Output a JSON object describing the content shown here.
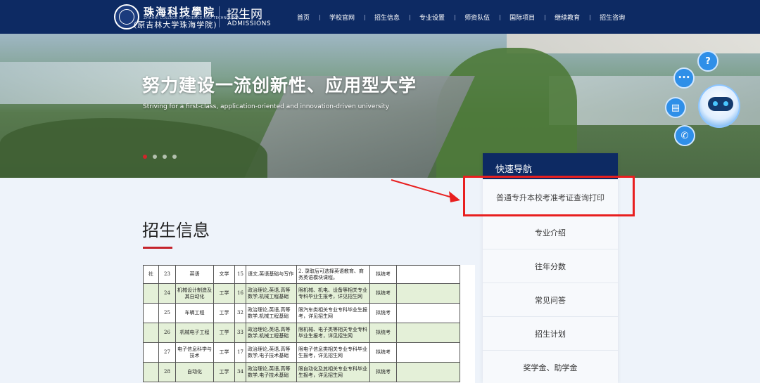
{
  "header": {
    "school_name": "珠海科技學院",
    "school_name_en": "ZHUHAI COLLEGE OF SCIENCE AND TECHNOLOGY",
    "school_sub": "(原吉林大学珠海学院)",
    "admissions_cn": "招生网",
    "admissions_en": "ADMISSIONS",
    "nav": [
      "首页",
      "学校官网",
      "招生信息",
      "专业设置",
      "师资队伍",
      "国际项目",
      "继续教育",
      "招生咨询"
    ]
  },
  "banner": {
    "title": "努力建设一流创新性、应用型大学",
    "subtitle": "Striving for a first-class, application-oriented and innovation-driven university",
    "dots": 4,
    "active_dot": 0
  },
  "assistant": {
    "icons": [
      "question-icon",
      "chat-icon",
      "book-icon",
      "phone-icon"
    ],
    "glyphs": [
      "?",
      "•••",
      "▤",
      "✆"
    ]
  },
  "main": {
    "section_title": "招生信息"
  },
  "table": {
    "rows": [
      {
        "c0": "社",
        "no": "23",
        "major": "英语",
        "cat": "文学",
        "plan": "15",
        "subjects": "语文,英语基础与写作",
        "req": "2. 录取后可选择英语教育、商务英语模块课程。",
        "mode": "拟统考",
        "style": "white"
      },
      {
        "c0": "",
        "no": "24",
        "major": "机械设计制造及其自动化",
        "cat": "工学",
        "plan": "16",
        "subjects": "政治理论,英语,高等数学,机械工程基础",
        "req": "限机械、机电、设备等相关专业专科毕业生报考，详见招生网",
        "mode": "拟统考",
        "style": "green"
      },
      {
        "c0": "",
        "no": "25",
        "major": "车辆工程",
        "cat": "工学",
        "plan": "32",
        "subjects": "政治理论,英语,高等数学,机械工程基础",
        "req": "限汽车类相关专业专科毕业生报考，详见招生网",
        "mode": "拟统考",
        "style": "white"
      },
      {
        "c0": "",
        "no": "26",
        "major": "机械电子工程",
        "cat": "工学",
        "plan": "33",
        "subjects": "政治理论,英语,高等数学,机械工程基础",
        "req": "限机械、电子类等相关专业专科毕业生报考，详见招生网",
        "mode": "拟统考",
        "style": "green"
      },
      {
        "c0": "",
        "no": "27",
        "major": "电子信息科学与技术",
        "cat": "工学",
        "plan": "17",
        "subjects": "政治理论,英语,高等数学,电子技术基础",
        "req": "限电子信息类相关专业专科毕业生报考，详见招生网",
        "mode": "拟统考",
        "style": "white"
      },
      {
        "c0": "",
        "no": "28",
        "major": "自动化",
        "cat": "工学",
        "plan": "34",
        "subjects": "政治理论,英语,高等数学,电子技术基础",
        "req": "限自动化及其相关专业专科毕业生报考，详见招生网",
        "mode": "拟统考",
        "style": "green"
      }
    ]
  },
  "quick_nav": {
    "title": "快速导航",
    "items": [
      "普通专升本校考准考证查询打印",
      "专业介绍",
      "往年分数",
      "常见问答",
      "招生计划",
      "奖学金、助学金"
    ]
  },
  "colors": {
    "header_bg": "#0d2a63",
    "accent_red": "#c5232b",
    "annotation_red": "#e81f1f"
  }
}
